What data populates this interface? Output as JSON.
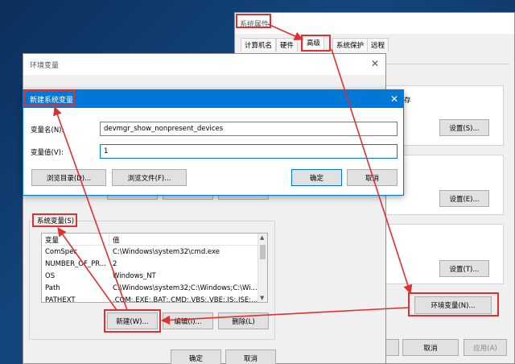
{
  "sys_props": {
    "title": "系统属性",
    "tabs": [
      {
        "label": "计算机名"
      },
      {
        "label": "硬件"
      },
      {
        "label": "高级"
      },
      {
        "label": "系统保护"
      },
      {
        "label": "远程"
      }
    ],
    "partial_text": "存",
    "settings_buttons": [
      "设置(S)...",
      "设置(E)...",
      "设置(T)..."
    ],
    "env_vars_button": "环境变量(N)...",
    "cancel": "取消",
    "apply": "应用(A)"
  },
  "env_vars": {
    "title": "环境变量",
    "system_vars_label": "系统变量(S)",
    "columns": [
      "变量",
      "值"
    ],
    "rows": [
      {
        "name": "ComSpec",
        "value": "C:\\Windows\\system32\\cmd.exe"
      },
      {
        "name": "NUMBER_OF_PR...",
        "value": "2"
      },
      {
        "name": "OS",
        "value": "Windows_NT"
      },
      {
        "name": "Path",
        "value": "C:\\Windows\\system32;C:\\Windows;C:\\Wi..."
      },
      {
        "name": "PATHEXT",
        "value": ".COM;.EXE;.BAT;.CMD;.VBS;.VBE;.JS;.JSE;..."
      }
    ],
    "new": "新建(W)...",
    "edit": "编辑(I)...",
    "delete": "删除(L)",
    "ok": "确定",
    "cancel": "取消"
  },
  "new_var": {
    "title": "新建系统变量",
    "name_label": "变量名(N):",
    "name_value": "devmgr_show_nonpresent_devices",
    "value_label": "变量值(V):",
    "value_value": "1",
    "browse_dir": "浏览目录(D)...",
    "browse_file": "浏览文件(F)...",
    "ok": "确定",
    "cancel": "取消"
  },
  "colors": {
    "annotation": "#e03030",
    "dialog_title_bar": "#0078d7",
    "desktop": "#14467e"
  }
}
